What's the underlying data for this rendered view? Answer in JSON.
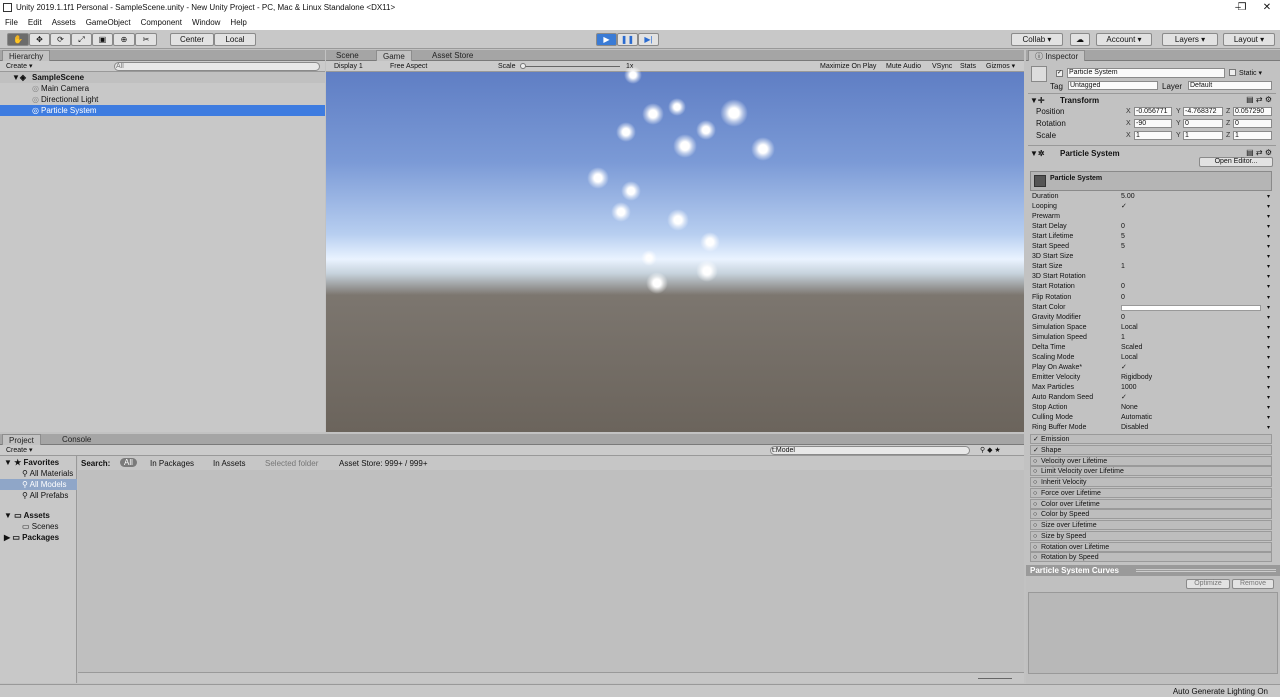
{
  "window": {
    "title": "Unity 2019.1.1f1 Personal - SampleScene.unity - New Unity Project - PC, Mac & Linux Standalone <DX11>",
    "minimize": "–",
    "maximize": "❐",
    "close": "✕"
  },
  "menu": [
    "File",
    "Edit",
    "Assets",
    "GameObject",
    "Component",
    "Window",
    "Help"
  ],
  "toolbar": {
    "center": "Center",
    "local": "Local",
    "collab": "Collab ▾",
    "account": "Account ▾",
    "layers": "Layers ▾",
    "layout": "Layout ▾"
  },
  "hierarchy": {
    "tab": "Hierarchy",
    "create": "Create ▾",
    "search_placeholder": "All",
    "scene": "SampleScene",
    "items": [
      "Main Camera",
      "Directional Light",
      "Particle System"
    ]
  },
  "view_tabs": [
    "Scene",
    "Game",
    "Asset Store"
  ],
  "game": {
    "display": "Display 1",
    "aspect": "Free Aspect",
    "scale_label": "Scale",
    "scale_value": "1x",
    "maximize": "Maximize On Play",
    "mute": "Mute Audio",
    "vsync": "VSync",
    "stats": "Stats",
    "gizmos": "Gizmos ▾"
  },
  "project": {
    "tab": "Project",
    "console_tab": "Console",
    "create": "Create ▾",
    "search_value": "t:Model",
    "search_label": "Search:",
    "filter_all": "All",
    "in_packages": "In Packages",
    "in_assets": "In Assets",
    "selected_folder": "Selected folder",
    "asset_store": "Asset Store: 999+ / 999+",
    "favorites_label": "Favorites",
    "favorites": [
      "All Materials",
      "All Models",
      "All Prefabs"
    ],
    "assets_label": "Assets",
    "assets": [
      "Scenes"
    ],
    "packages_label": "Packages"
  },
  "inspector": {
    "tab": "Inspector",
    "object_name": "Particle System",
    "static": "Static ▾",
    "tag_label": "Tag",
    "tag": "Untagged",
    "layer_label": "Layer",
    "layer": "Default",
    "transform": {
      "title": "Transform",
      "position_label": "Position",
      "rotation_label": "Rotation",
      "scale_label": "Scale",
      "position": [
        "-0.056771",
        "-4.768372",
        "0.057290"
      ],
      "rotation": [
        "-90",
        "0",
        "0"
      ],
      "scale": [
        "1",
        "1",
        "1"
      ]
    },
    "ps_title": "Particle System",
    "open_editor": "Open Editor...",
    "ps_sub": "Particle System",
    "props": [
      {
        "label": "Duration",
        "value": "5.00"
      },
      {
        "label": "Looping",
        "value": "✓"
      },
      {
        "label": "Prewarm",
        "value": ""
      },
      {
        "label": "Start Delay",
        "value": "0"
      },
      {
        "label": "Start Lifetime",
        "value": "5"
      },
      {
        "label": "Start Speed",
        "value": "5"
      },
      {
        "label": "3D Start Size",
        "value": ""
      },
      {
        "label": "Start Size",
        "value": "1"
      },
      {
        "label": "3D Start Rotation",
        "value": ""
      },
      {
        "label": "Start Rotation",
        "value": "0"
      },
      {
        "label": "Flip Rotation",
        "value": "0"
      },
      {
        "label": "Start Color",
        "value": ""
      },
      {
        "label": "Gravity Modifier",
        "value": "0"
      },
      {
        "label": "Simulation Space",
        "value": "Local"
      },
      {
        "label": "Simulation Speed",
        "value": "1"
      },
      {
        "label": "Delta Time",
        "value": "Scaled"
      },
      {
        "label": "Scaling Mode",
        "value": "Local"
      },
      {
        "label": "Play On Awake*",
        "value": "✓"
      },
      {
        "label": "Emitter Velocity",
        "value": "Rigidbody"
      },
      {
        "label": "Max Particles",
        "value": "1000"
      },
      {
        "label": "Auto Random Seed",
        "value": "✓"
      },
      {
        "label": "Stop Action",
        "value": "None"
      },
      {
        "label": "Culling Mode",
        "value": "Automatic"
      },
      {
        "label": "Ring Buffer Mode",
        "value": "Disabled"
      }
    ],
    "modules": [
      "Emission",
      "Shape",
      "Velocity over Lifetime",
      "Limit Velocity over Lifetime",
      "Inherit Velocity",
      "Force over Lifetime",
      "Color over Lifetime",
      "Color by Speed",
      "Size over Lifetime",
      "Size by Speed",
      "Rotation over Lifetime",
      "Rotation by Speed"
    ],
    "curves_title": "Particle System Curves",
    "optimize": "Optimize",
    "remove": "Remove"
  },
  "status": "Auto Generate Lighting On"
}
